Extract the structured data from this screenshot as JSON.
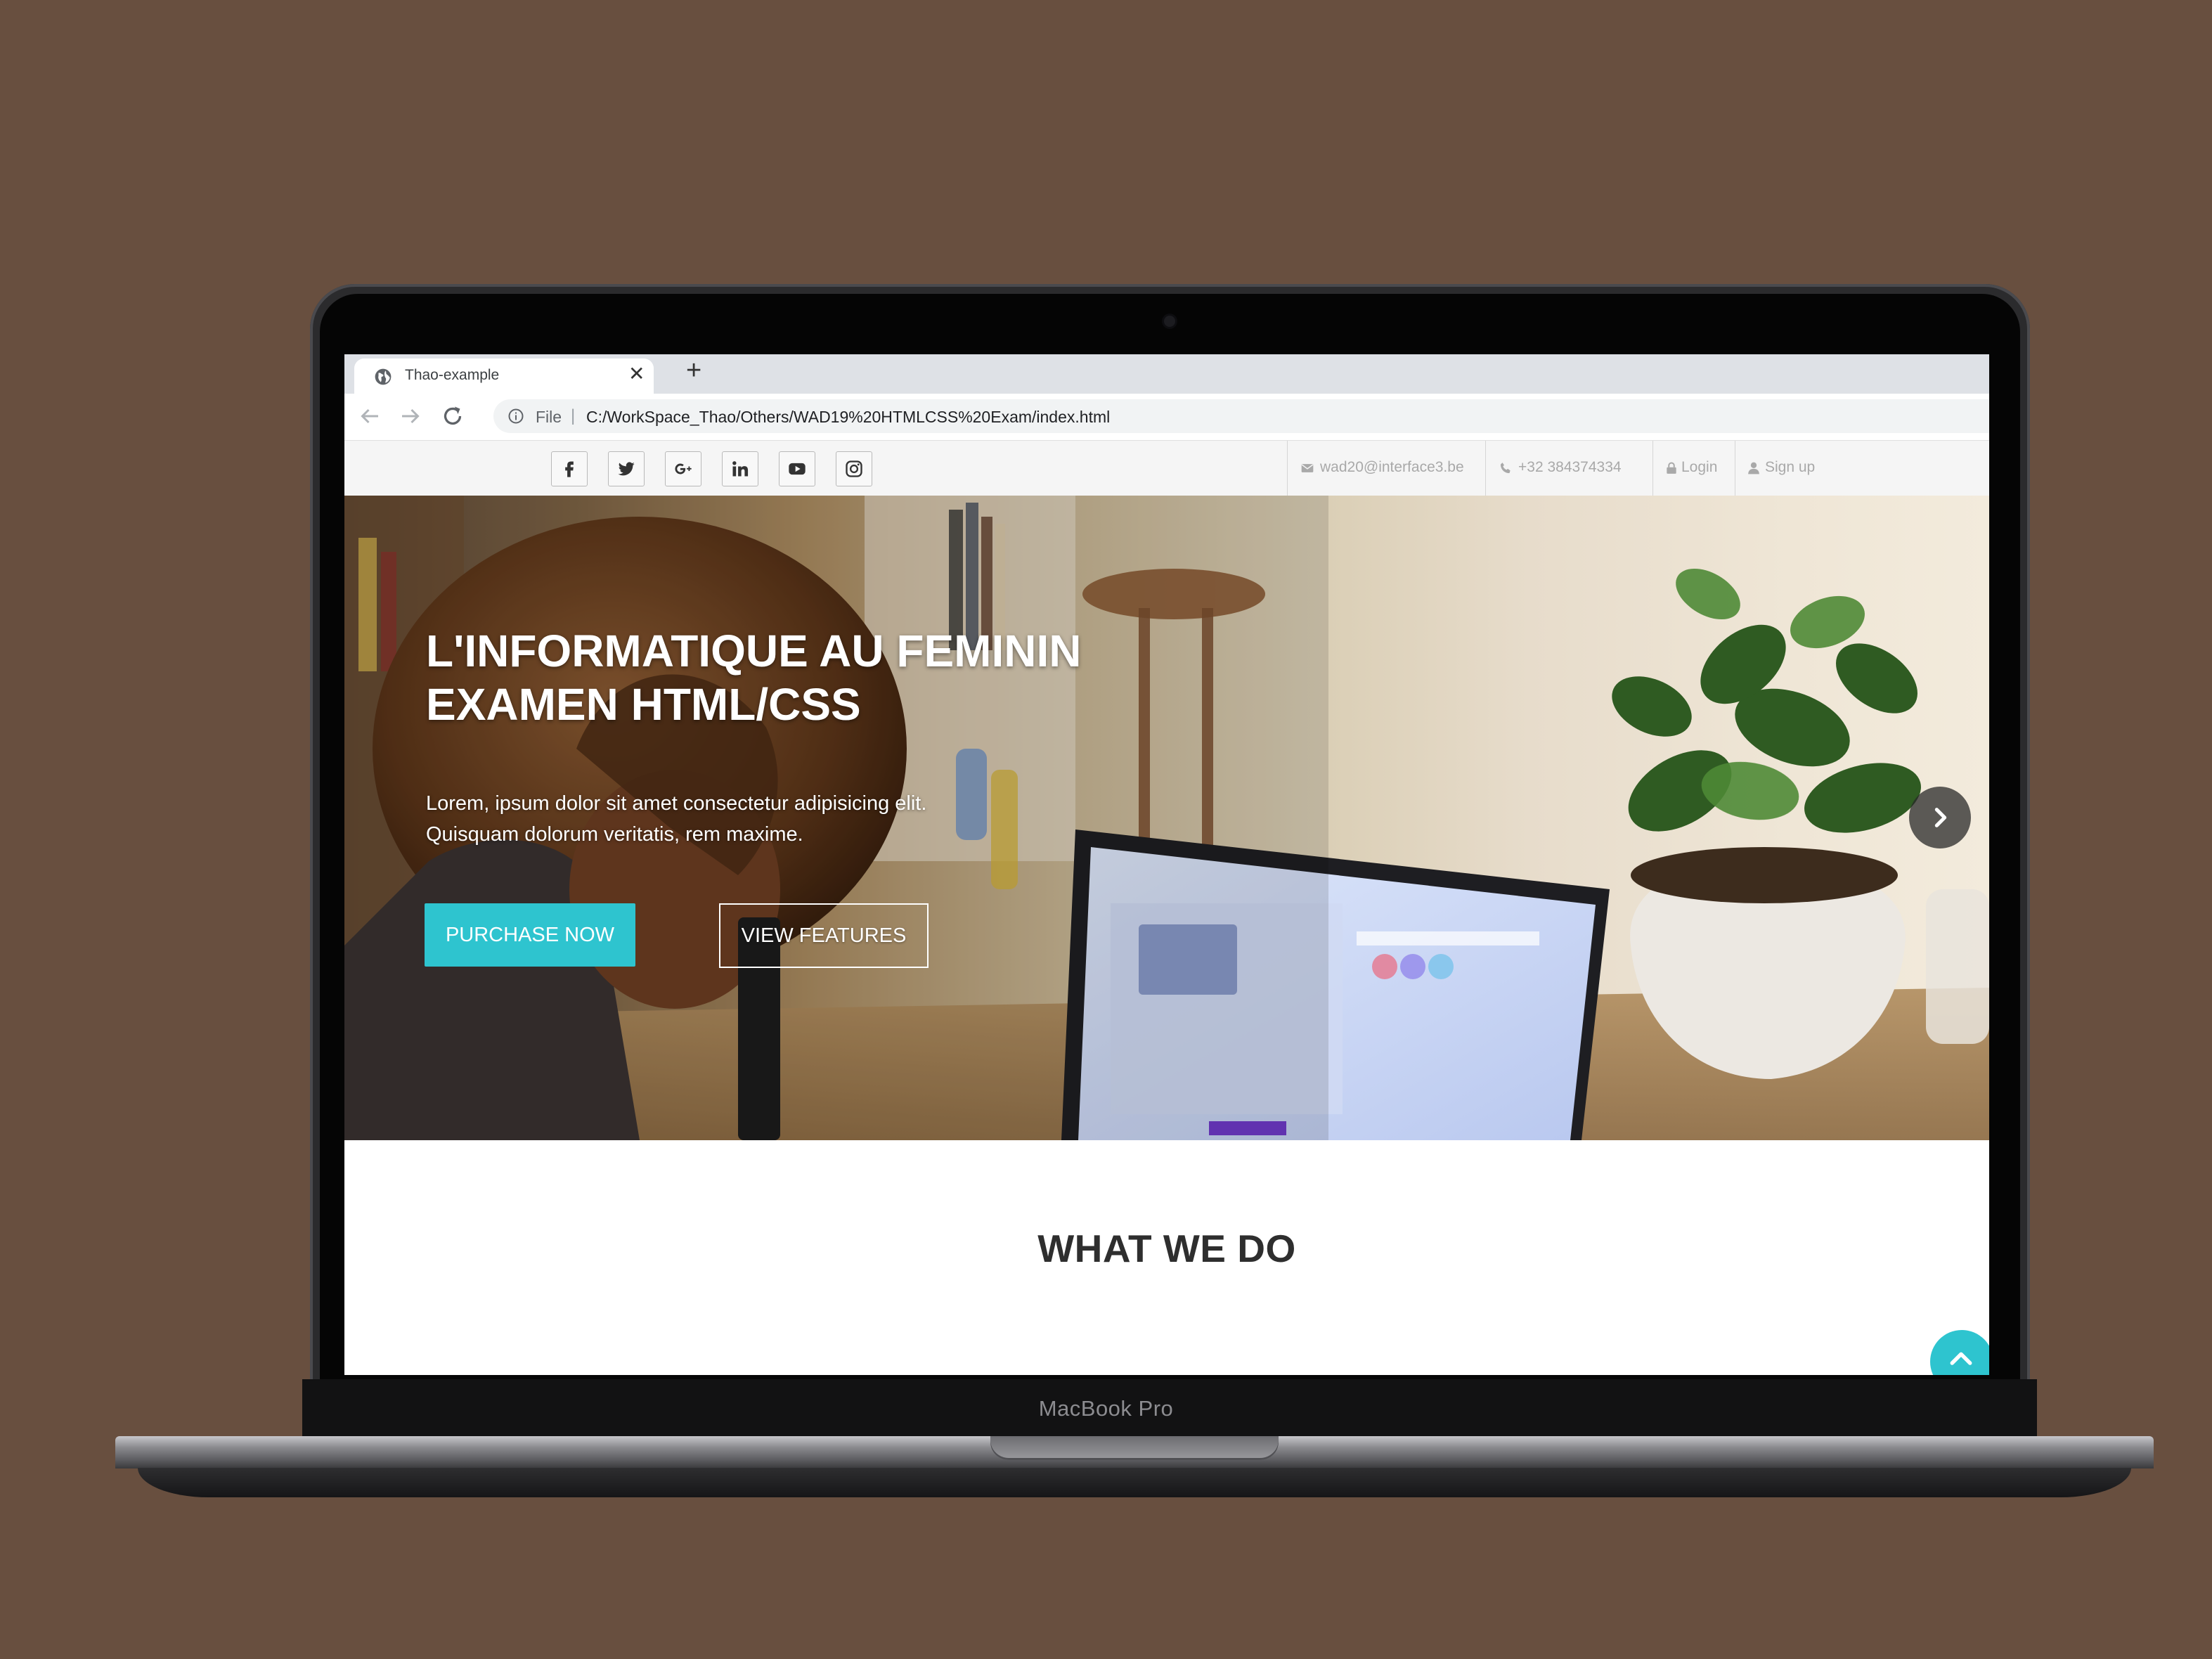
{
  "device": {
    "brand_label": "MacBook Pro"
  },
  "browser": {
    "tab": {
      "title": "Thao-example",
      "close_symbol": "✕",
      "favicon": "globe-icon"
    },
    "new_tab_symbol": "+",
    "address": {
      "scheme_label": "File",
      "separator": "|",
      "url": "C:/WorkSpace_Thao/Others/WAD19%20HTMLCSS%20Exam/index.html"
    }
  },
  "topbar": {
    "social": [
      "facebook-icon",
      "twitter-icon",
      "google-plus-icon",
      "linkedin-icon",
      "youtube-icon",
      "instagram-icon"
    ],
    "email": "wad20@interface3.be",
    "phone": "+32 384374334",
    "login": "Login",
    "signup": "Sign up"
  },
  "hero": {
    "title_line1": "L'INFORMATIQUE AU FEMININ",
    "title_line2": "EXAMEN HTML/CSS",
    "text_line1": "Lorem, ipsum dolor sit amet consectetur adipisicing elit.",
    "text_line2": "Quisquam dolorum veritatis, rem maxime.",
    "primary_button": "PURCHASE NOW",
    "secondary_button": "VIEW FEATURES",
    "next_icon": "chevron-right-icon"
  },
  "section": {
    "title": "WHAT WE DO"
  },
  "colors": {
    "background": "#684f3f",
    "accent": "#2ec4cf",
    "topbar_text": "#a9a9a9",
    "tabstrip": "#dee1e6"
  }
}
